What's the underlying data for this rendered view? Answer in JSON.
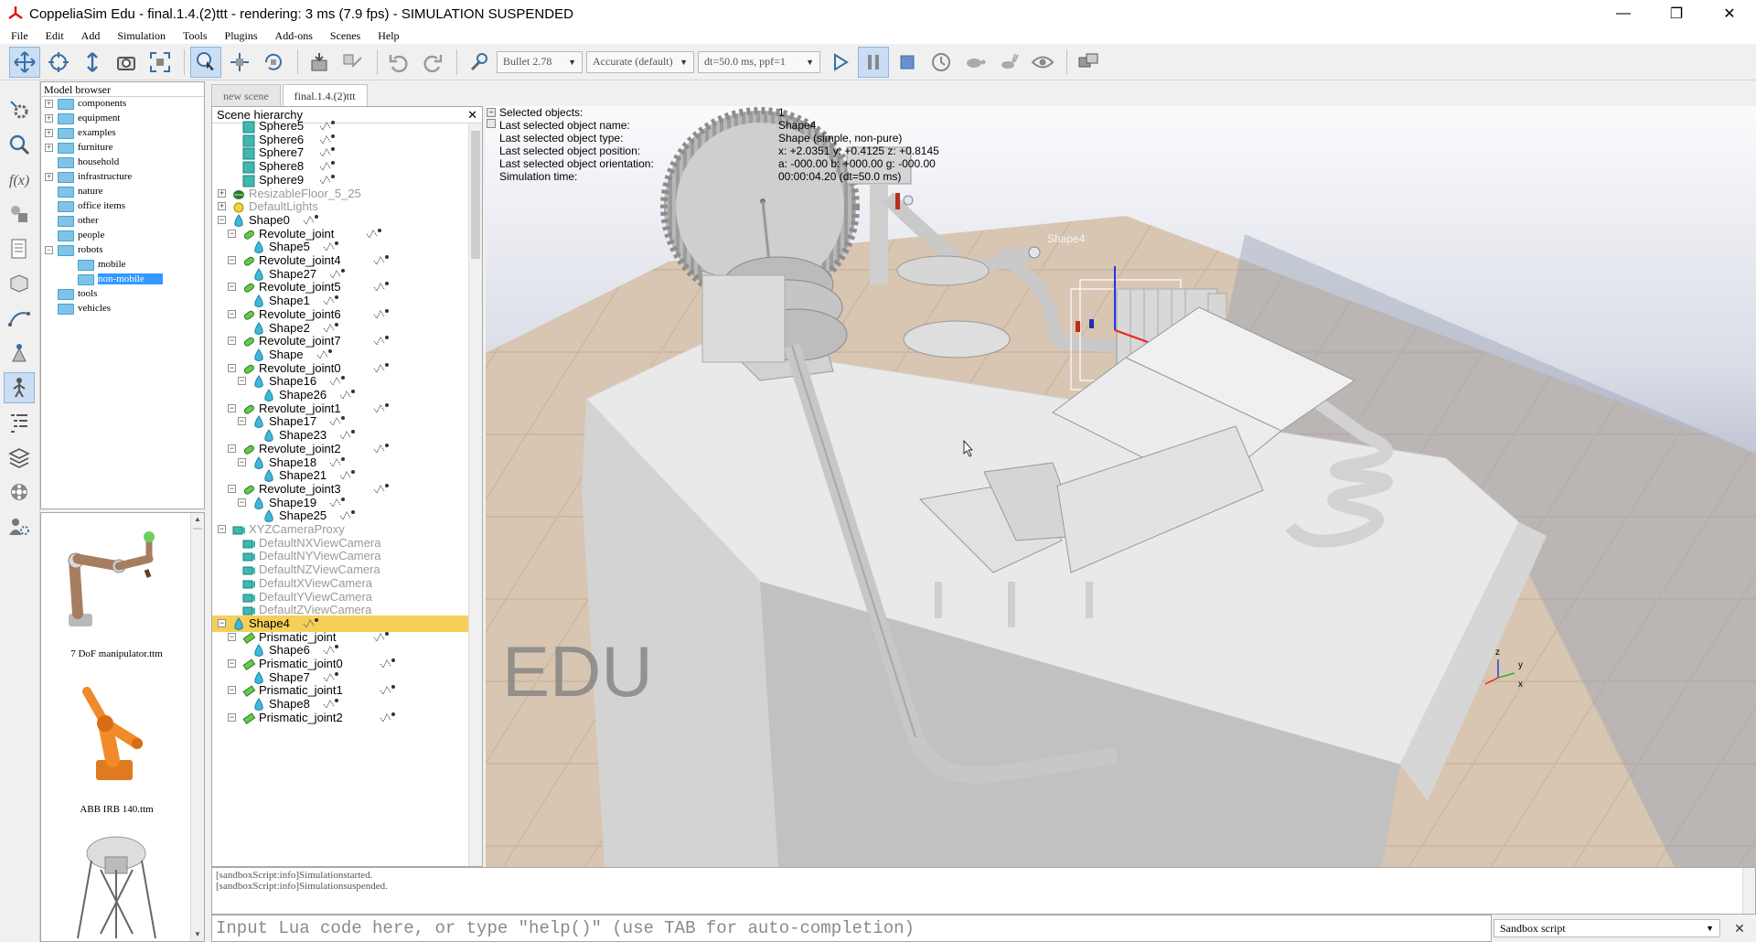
{
  "window": {
    "title": "CoppeliaSim Edu - final.1.4.(2)ttt - rendering: 3 ms (7.9 fps) - SIMULATION SUSPENDED",
    "minimize": "—",
    "restore": "❐",
    "close": "✕"
  },
  "menu": [
    "File",
    "Edit",
    "Add",
    "Simulation",
    "Tools",
    "Plugins",
    "Add-ons",
    "Scenes",
    "Help"
  ],
  "toolbar": {
    "engine": "Bullet 2.78",
    "accuracy": "Accurate (default)",
    "timestep": "dt=50.0 ms, ppf=1"
  },
  "model_browser": {
    "header": "Model browser",
    "items": [
      {
        "label": "components",
        "expander": "+"
      },
      {
        "label": "equipment",
        "expander": "+"
      },
      {
        "label": "examples",
        "expander": "+"
      },
      {
        "label": "furniture",
        "expander": "+"
      },
      {
        "label": "household",
        "expander": ""
      },
      {
        "label": "infrastructure",
        "expander": "+"
      },
      {
        "label": "nature",
        "expander": ""
      },
      {
        "label": "office items",
        "expander": ""
      },
      {
        "label": "other",
        "expander": ""
      },
      {
        "label": "people",
        "expander": ""
      },
      {
        "label": "robots",
        "expander": "−"
      },
      {
        "label": "mobile",
        "expander": ""
      },
      {
        "label": "non-mobile",
        "expander": ""
      },
      {
        "label": "tools",
        "expander": ""
      },
      {
        "label": "vehicles",
        "expander": ""
      }
    ],
    "thumbnails": [
      "7 DoF manipulator.ttm",
      "ABB IRB 140.ttm"
    ]
  },
  "tabs": [
    "new scene",
    "final.1.4.(2)ttt"
  ],
  "scene_hierarchy": {
    "header": "Scene hierarchy",
    "close": "✕",
    "items": [
      {
        "name": "Sphere5",
        "expander": ""
      },
      {
        "name": "Sphere6",
        "expander": ""
      },
      {
        "name": "Sphere7",
        "expander": ""
      },
      {
        "name": "Sphere8",
        "expander": ""
      },
      {
        "name": "Sphere9",
        "expander": ""
      },
      {
        "name": "ResizableFloor_5_25",
        "expander": "+"
      },
      {
        "name": "DefaultLights",
        "expander": "+"
      },
      {
        "name": "Shape0",
        "expander": "−"
      },
      {
        "name": "Revolute_joint",
        "expander": "−"
      },
      {
        "name": "Shape5",
        "expander": ""
      },
      {
        "name": "Revolute_joint4",
        "expander": "−"
      },
      {
        "name": "Shape27",
        "expander": ""
      },
      {
        "name": "Revolute_joint5",
        "expander": "−"
      },
      {
        "name": "Shape1",
        "expander": ""
      },
      {
        "name": "Revolute_joint6",
        "expander": "−"
      },
      {
        "name": "Shape2",
        "expander": ""
      },
      {
        "name": "Revolute_joint7",
        "expander": "−"
      },
      {
        "name": "Shape",
        "expander": ""
      },
      {
        "name": "Revolute_joint0",
        "expander": "−"
      },
      {
        "name": "Shape16",
        "expander": "−"
      },
      {
        "name": "Shape26",
        "expander": ""
      },
      {
        "name": "Revolute_joint1",
        "expander": "−"
      },
      {
        "name": "Shape17",
        "expander": "−"
      },
      {
        "name": "Shape23",
        "expander": ""
      },
      {
        "name": "Revolute_joint2",
        "expander": "−"
      },
      {
        "name": "Shape18",
        "expander": "−"
      },
      {
        "name": "Shape21",
        "expander": ""
      },
      {
        "name": "Revolute_joint3",
        "expander": "−"
      },
      {
        "name": "Shape19",
        "expander": "−"
      },
      {
        "name": "Shape25",
        "expander": ""
      },
      {
        "name": "XYZCameraProxy",
        "expander": "−"
      },
      {
        "name": "DefaultNXViewCamera",
        "expander": ""
      },
      {
        "name": "DefaultNYViewCamera",
        "expander": ""
      },
      {
        "name": "DefaultNZViewCamera",
        "expander": ""
      },
      {
        "name": "DefaultXViewCamera",
        "expander": ""
      },
      {
        "name": "DefaultYViewCamera",
        "expander": ""
      },
      {
        "name": "DefaultZViewCamera",
        "expander": ""
      },
      {
        "name": "Shape4",
        "expander": "−"
      },
      {
        "name": "Prismatic_joint",
        "expander": "−"
      },
      {
        "name": "Shape6",
        "expander": ""
      },
      {
        "name": "Prismatic_joint0",
        "expander": "−"
      },
      {
        "name": "Shape7",
        "expander": ""
      },
      {
        "name": "Prismatic_joint1",
        "expander": "−"
      },
      {
        "name": "Shape8",
        "expander": ""
      },
      {
        "name": "Prismatic_joint2",
        "expander": "−"
      }
    ]
  },
  "selection_info": {
    "labels": [
      "Selected objects:",
      "Last selected object name:",
      "Last selected object type:",
      "Last selected object position:",
      "Last selected object orientation:",
      "Simulation time:"
    ],
    "values": [
      "1",
      "Shape4",
      "Shape (simple, non-pure)",
      "x: +2.0351    y: +0.4125    z: +0.8145",
      "a: -000.00    b: +000.00    g: -000.00",
      "00:00:04.20 (dt=50.0 ms)"
    ]
  },
  "viewport": {
    "watermark": "EDU",
    "object_label": "Shape4",
    "axis_x": "x",
    "axis_y": "y",
    "axis_z": "z"
  },
  "console": {
    "lines": [
      "[sandboxScript:info]Simulationstarted.",
      "[sandboxScript:info]Simulationsuspended."
    ]
  },
  "command": {
    "placeholder": "Input Lua code here, or type \"help()\" (use TAB for auto-completion)",
    "script_select": "Sandbox script",
    "close": "✕"
  }
}
